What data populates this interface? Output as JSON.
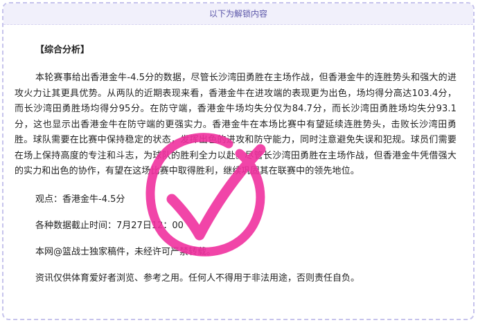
{
  "banner": {
    "text": "以下为解锁内容"
  },
  "article": {
    "section_title": "【综合分析】",
    "analysis": "本轮赛事给出香港金牛-4.5分的数据，尽管长沙湾田勇胜在主场作战，但香港金牛的连胜势头和强大的进攻火力让其更具优势。从两队的近期表现来看，香港金牛在进攻端的表现更为出色，场均得分高达103.4分，而长沙湾田勇胜场均得分95分。在防守端，香港金牛场均失分仅为84.7分，而长沙湾田勇胜场均失分93.1分，这也显示出香港金牛在防守端的更强实力。香港金牛在本场比赛中有望延续连胜势头，击败长沙湾田勇胜。球队需要在比赛中保持稳定的状态，发挥出色的进攻和防守能力，同时注意避免失误和犯规。球员们需要在场上保持高度的专注和斗志，为球队的胜利全力以赴。尽管长沙湾田勇胜在主场作战，但香港金牛凭借强大的实力和出色的协作，有望在这场比赛中取得胜利，继续巩固其在联赛中的领先地位。",
    "viewpoint": "观点：香港金牛-4.5分",
    "cutoff": "各种数据截止时间：7月27日12：00",
    "copyright": "本网@篮战士独家稿件，未经许可严禁转载。",
    "disclaimer": "资讯仅供体育爱好者浏览、参考之用。任何人不得用于非法用途，否则责任自负。"
  },
  "stamp": {
    "icon": "check-stamp-icon",
    "color": "#f0319f"
  },
  "colors": {
    "border": "#c6c3ec",
    "banner_bg": "#f1f0fb",
    "banner_text": "#5a55a8",
    "body_text": "#222222"
  }
}
